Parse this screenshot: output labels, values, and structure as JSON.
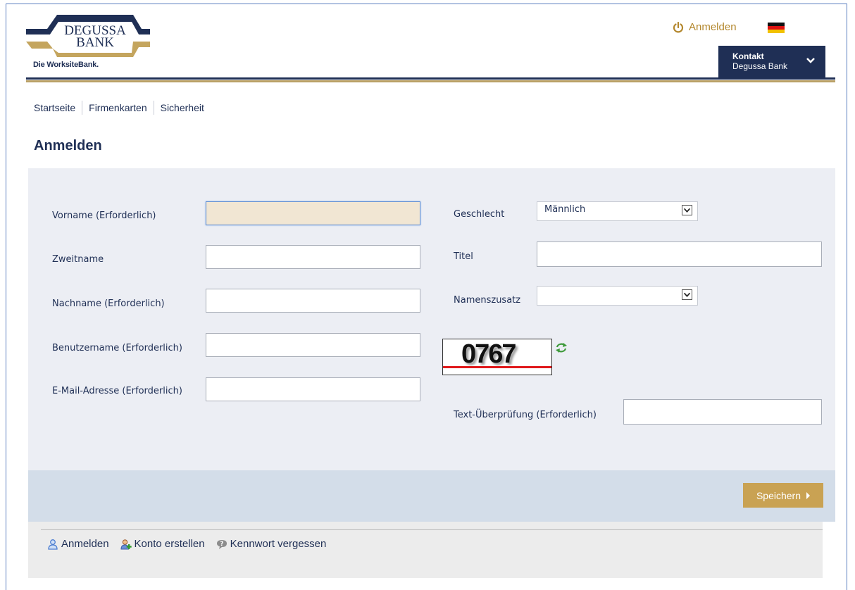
{
  "header": {
    "logo_line1": "DEGUSSA",
    "logo_line2": "BANK",
    "logo_tagline": "Die WorksiteBank.",
    "login_link": "Anmelden",
    "contact_title": "Kontakt",
    "contact_sub": "Degussa Bank"
  },
  "breadcrumb": [
    "Startseite",
    "Firmenkarten",
    "Sicherheit"
  ],
  "page_title": "Anmelden",
  "form": {
    "left": {
      "first_name_label": "Vorname (Erforderlich)",
      "middle_name_label": "Zweitname",
      "last_name_label": "Nachname (Erforderlich)",
      "username_label": "Benutzername (Erforderlich)",
      "email_label": "E-Mail-Adresse (Erforderlich)"
    },
    "right": {
      "gender_label": "Geschlecht",
      "gender_value": "Männlich",
      "title_label": "Titel",
      "suffix_label": "Namenszusatz",
      "suffix_value": "",
      "captcha_text": "0767",
      "verify_label": "Text-Überprüfung (Erforderlich)"
    },
    "save_label": "Speichern"
  },
  "footer": {
    "login": "Anmelden",
    "create_account": "Konto erstellen",
    "forgot_password": "Kennwort vergessen"
  },
  "colors": {
    "navy": "#1f2f55",
    "gold": "#c9a253",
    "panel": "#eceef4",
    "action_bar": "#d3dde9"
  }
}
